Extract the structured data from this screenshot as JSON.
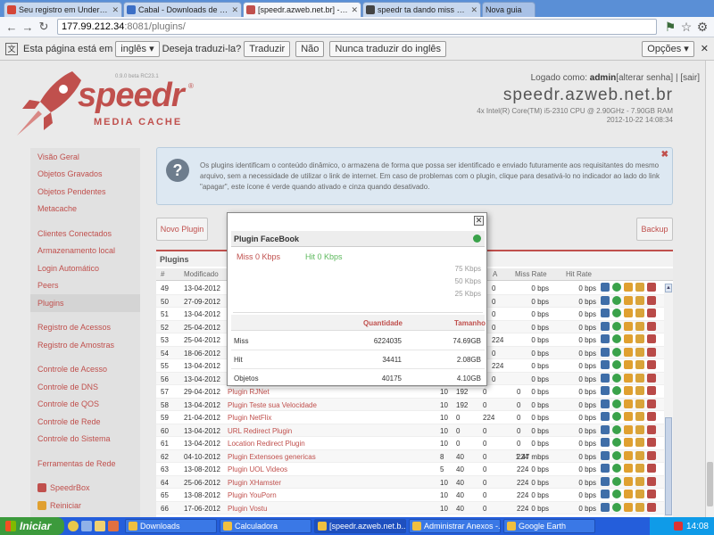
{
  "browser": {
    "tabs": [
      {
        "title": "Seu registro em Under-Linux",
        "color": "#d44638"
      },
      {
        "title": "Cabal - Downloads de Cheats",
        "color": "#3b6fc6"
      },
      {
        "title": "[speedr.azweb.net.br] - Speedr",
        "color": "#c0504d",
        "active": true
      },
      {
        "title": "speedr ta dando miss hate em",
        "color": "#444"
      },
      {
        "title": "Nova guia",
        "color": "#aaa",
        "is_new": true
      }
    ],
    "url_host": "177.99.212.34",
    "url_path": ":8081/plugins/"
  },
  "translate": {
    "prefix": "Esta página está em",
    "language": "inglês",
    "question": "Deseja traduzi-la?",
    "translate_btn": "Traduzir",
    "no_btn": "Não",
    "never_btn": "Nunca traduzir do inglês",
    "options_btn": "Opções"
  },
  "header": {
    "version": "0.9.0 beta RC23.1",
    "brand": "speedr",
    "brand_sub": "MEDIA CACHE",
    "login_prefix": "Logado como:",
    "login_user": "admin",
    "login_change": "[alterar senha]",
    "login_sep": "|",
    "login_logout": "[sair]",
    "host": "speedr.azweb.net.br",
    "cpu": "4x Intel(R) Core(TM) i5-2310 CPU @ 2.90GHz - 7.90GB RAM",
    "datetime": "2012-10-22 14:08:34"
  },
  "sidebar": {
    "group1": [
      "Visão Geral",
      "Objetos Gravados",
      "Objetos Pendentes",
      "Metacache"
    ],
    "group2": [
      "Clientes Conectados",
      "Armazenamento local",
      "Login Automático",
      "Peers",
      "Plugins"
    ],
    "group3": [
      "Registro de Acessos",
      "Registro de Amostras"
    ],
    "group4": [
      "Controle de Acesso",
      "Controle de DNS",
      "Controle de QOS",
      "Controle de Rede",
      "Controle do Sistema"
    ],
    "group5": [
      "Ferramentas de Rede"
    ],
    "group6": [
      "SpeedrBox",
      "Reiniciar"
    ],
    "selected": "Plugins"
  },
  "info": {
    "text": "Os plugins identificam o conteúdo dinâmico, o armazena de forma que possa ser identificado e enviado futuramente aos requisitantes do mesmo arquivo, sem a necessidade de utilizar o link de internet. Em caso de problemas com o plugin, clique para desativá-lo no indicador ao lado do link \"apagar\", este ícone é verde quando ativado e cinza quando desativado."
  },
  "buttons": {
    "new_plugin": "Novo Plugin",
    "backup": "Backup"
  },
  "grid": {
    "title": "Plugins",
    "headers": {
      "num": "#",
      "modified": "Modificado",
      "a": "A",
      "miss_rate": "Miss Rate",
      "hit_rate": "Hit Rate"
    },
    "rows": [
      {
        "n": "49",
        "date": "13-04-2012",
        "name": "",
        "c1": "",
        "c2": "",
        "c3": "0",
        "c4": "0",
        "miss": "0 bps",
        "hit": "0 bps"
      },
      {
        "n": "50",
        "date": "27-09-2012",
        "name": "",
        "c1": "",
        "c2": "",
        "c3": "0",
        "c4": "0",
        "miss": "0 bps",
        "hit": "0 bps"
      },
      {
        "n": "51",
        "date": "13-04-2012",
        "name": "",
        "c1": "",
        "c2": "",
        "c3": "0",
        "c4": "0",
        "miss": "0 bps",
        "hit": "0 bps"
      },
      {
        "n": "52",
        "date": "25-04-2012",
        "name": "",
        "c1": "",
        "c2": "",
        "c3": "0",
        "c4": "0",
        "miss": "0 bps",
        "hit": "0 bps"
      },
      {
        "n": "53",
        "date": "25-04-2012",
        "name": "",
        "c1": "",
        "c2": "",
        "c3": "224",
        "c4": "0",
        "miss": "0 bps",
        "hit": "0 bps"
      },
      {
        "n": "54",
        "date": "18-06-2012",
        "name": "",
        "c1": "",
        "c2": "",
        "c3": "0",
        "c4": "0",
        "miss": "0 bps",
        "hit": "0 bps"
      },
      {
        "n": "55",
        "date": "13-04-2012",
        "name": "",
        "c1": "",
        "c2": "",
        "c3": "224",
        "c4": "0",
        "miss": "0 bps",
        "hit": "0 bps"
      },
      {
        "n": "56",
        "date": "13-04-2012",
        "name": "",
        "c1": "",
        "c2": "",
        "c3": "0",
        "c4": "0",
        "miss": "0 bps",
        "hit": "0 bps"
      },
      {
        "n": "57",
        "date": "29-04-2012",
        "name": "Plugin RJNet",
        "c1": "10",
        "c2": "192",
        "c3": "0",
        "c4": "0",
        "miss": "0 bps",
        "hit": "0 bps"
      },
      {
        "n": "58",
        "date": "13-04-2012",
        "name": "Plugin Teste sua Velocidade",
        "c1": "10",
        "c2": "192",
        "c3": "0",
        "c4": "0",
        "miss": "0 bps",
        "hit": "0 bps"
      },
      {
        "n": "59",
        "date": "21-04-2012",
        "name": "Plugin NetFlix",
        "c1": "10",
        "c2": "0",
        "c3": "224",
        "c4": "0",
        "miss": "0 bps",
        "hit": "0 bps"
      },
      {
        "n": "60",
        "date": "13-04-2012",
        "name": "URL Redirect Plugin",
        "c1": "10",
        "c2": "0",
        "c3": "0",
        "c4": "0",
        "miss": "0 bps",
        "hit": "0 bps"
      },
      {
        "n": "61",
        "date": "13-04-2012",
        "name": "Location Redirect Plugin",
        "c1": "10",
        "c2": "0",
        "c3": "0",
        "c4": "0",
        "miss": "0 bps",
        "hit": "0 bps"
      },
      {
        "n": "62",
        "date": "04-10-2012",
        "name": "Plugin Extensoes genericas",
        "c1": "8",
        "c2": "40",
        "c3": "0",
        "c4": "224",
        "miss": "1.47 mbps",
        "hit": "0 bps"
      },
      {
        "n": "63",
        "date": "13-08-2012",
        "name": "Plugin UOL Videos",
        "c1": "5",
        "c2": "40",
        "c3": "0",
        "c4": "224",
        "miss": "0 bps",
        "hit": "0 bps"
      },
      {
        "n": "64",
        "date": "25-06-2012",
        "name": "Plugin XHamster",
        "c1": "10",
        "c2": "40",
        "c3": "0",
        "c4": "224",
        "miss": "0 bps",
        "hit": "0 bps"
      },
      {
        "n": "65",
        "date": "13-08-2012",
        "name": "Plugin YouPorn",
        "c1": "10",
        "c2": "40",
        "c3": "0",
        "c4": "224",
        "miss": "0 bps",
        "hit": "0 bps"
      },
      {
        "n": "66",
        "date": "17-06-2012",
        "name": "Plugin Vostu",
        "c1": "10",
        "c2": "40",
        "c3": "0",
        "c4": "224",
        "miss": "0 bps",
        "hit": "0 bps"
      }
    ]
  },
  "popup": {
    "title": "Plugin FaceBook",
    "miss_label": "Miss 0 Kbps",
    "hit_label": "Hit 0 Kbps",
    "y_ticks": [
      "75 Kbps",
      "50 Kbps",
      "25 Kbps"
    ],
    "col_qty": "Quantidade",
    "col_size": "Tamanho",
    "rows": [
      {
        "label": "Miss",
        "qty": "6224035",
        "size": "74.69GB"
      },
      {
        "label": "Hit",
        "qty": "34411",
        "size": "2.08GB"
      },
      {
        "label": "Objetos",
        "qty": "40175",
        "size": "4.10GB"
      }
    ]
  },
  "taskbar": {
    "start": "Iniciar",
    "tasks": [
      "Downloads",
      "Calculadora",
      "[speedr.azweb.net.b...",
      "Administrar Anexos -...",
      "Google Earth"
    ],
    "active_task": 2,
    "clock": "14:08"
  }
}
